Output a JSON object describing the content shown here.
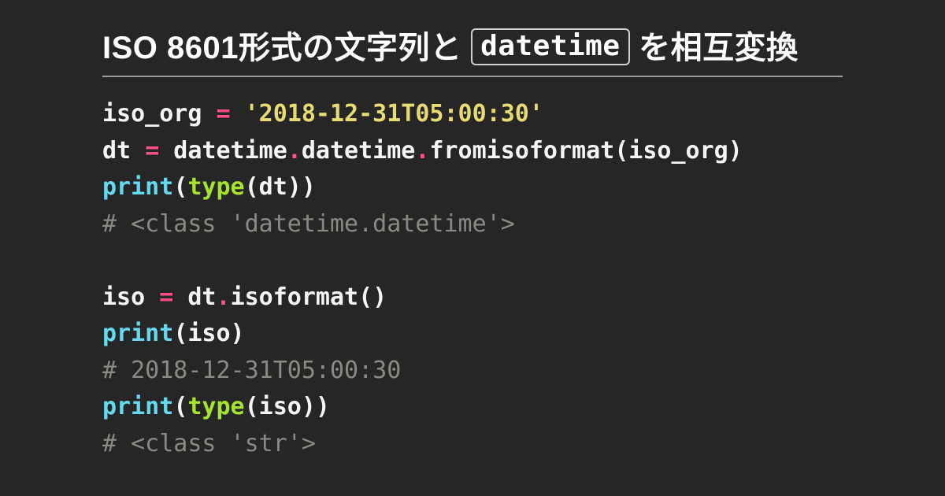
{
  "title": {
    "pre": "ISO 8601形式の文字列と",
    "code": "datetime",
    "post": "を相互変換"
  },
  "code": {
    "lines": [
      [
        {
          "t": "iso_org ",
          "c": "default"
        },
        {
          "t": "=",
          "c": "op"
        },
        {
          "t": " ",
          "c": "default"
        },
        {
          "t": "'2018-12-31T05:00:30'",
          "c": "string"
        }
      ],
      [
        {
          "t": "dt ",
          "c": "default"
        },
        {
          "t": "=",
          "c": "op"
        },
        {
          "t": " datetime",
          "c": "default"
        },
        {
          "t": ".",
          "c": "op"
        },
        {
          "t": "datetime",
          "c": "default"
        },
        {
          "t": ".",
          "c": "op"
        },
        {
          "t": "fromisoformat(iso_org)",
          "c": "default"
        }
      ],
      [
        {
          "t": "print",
          "c": "builtin"
        },
        {
          "t": "(",
          "c": "default"
        },
        {
          "t": "type",
          "c": "func"
        },
        {
          "t": "(dt))",
          "c": "default"
        }
      ],
      [
        {
          "t": "# <class 'datetime.datetime'>",
          "c": "comment"
        }
      ],
      [
        {
          "t": " ",
          "c": "default"
        }
      ],
      [
        {
          "t": "iso ",
          "c": "default"
        },
        {
          "t": "=",
          "c": "op"
        },
        {
          "t": " dt",
          "c": "default"
        },
        {
          "t": ".",
          "c": "op"
        },
        {
          "t": "isoformat()",
          "c": "default"
        }
      ],
      [
        {
          "t": "print",
          "c": "builtin"
        },
        {
          "t": "(iso)",
          "c": "default"
        }
      ],
      [
        {
          "t": "# 2018-12-31T05:00:30",
          "c": "comment"
        }
      ],
      [
        {
          "t": "print",
          "c": "builtin"
        },
        {
          "t": "(",
          "c": "default"
        },
        {
          "t": "type",
          "c": "func"
        },
        {
          "t": "(iso))",
          "c": "default"
        }
      ],
      [
        {
          "t": "# <class 'str'>",
          "c": "comment"
        }
      ]
    ]
  }
}
